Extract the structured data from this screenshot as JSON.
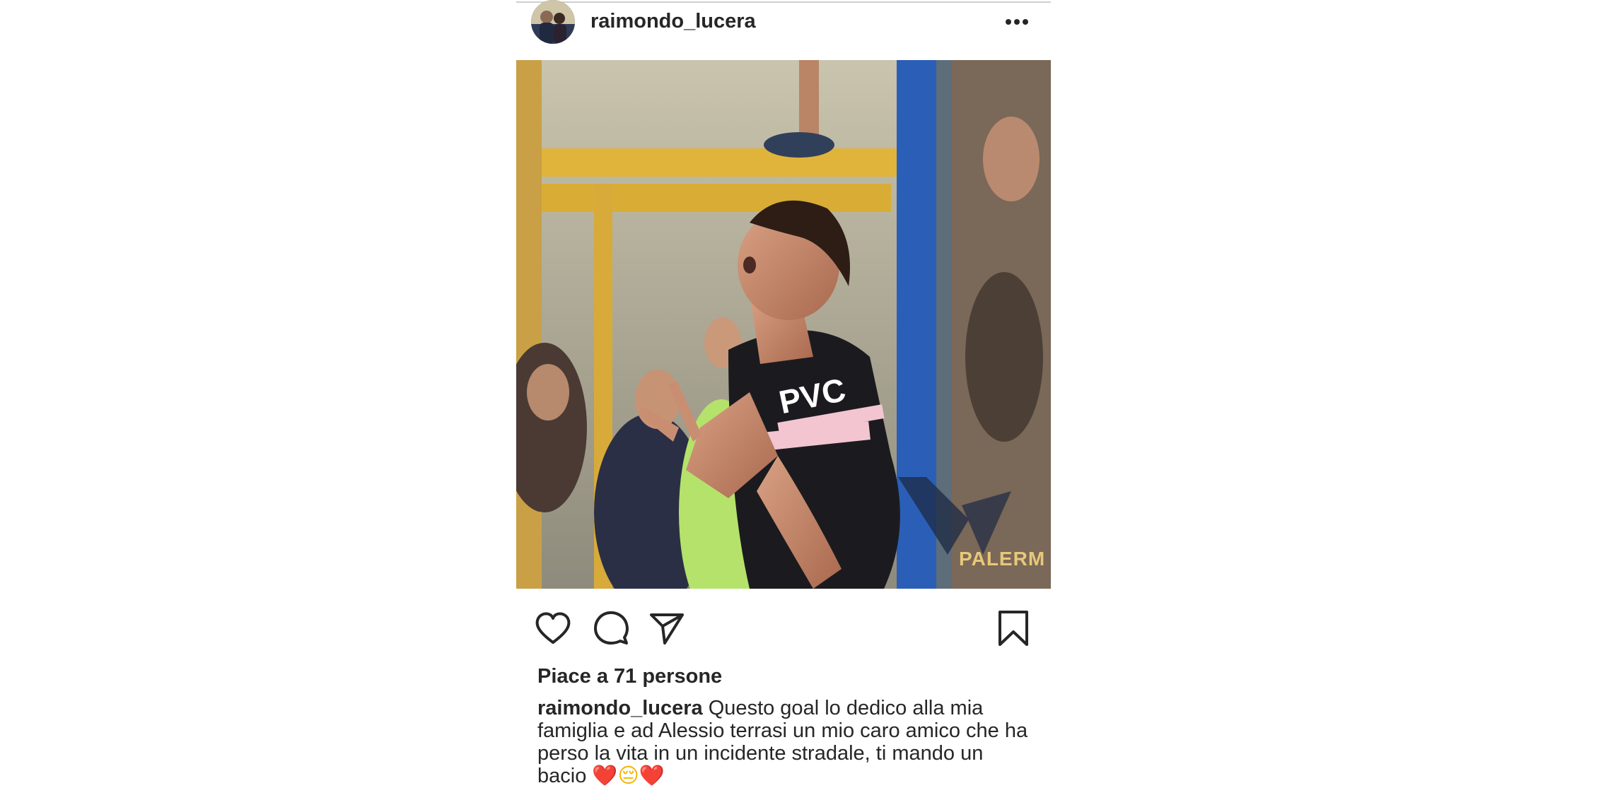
{
  "post": {
    "username": "raimondo_lucera",
    "more_label": "•••",
    "image": {
      "description_visible_text": "PALERM"
    },
    "actions": {
      "like_icon": "heart-outline-icon",
      "comment_icon": "comment-bubble-icon",
      "share_icon": "paper-plane-icon",
      "save_icon": "bookmark-icon"
    },
    "likes_text": "Piace a 71 persone",
    "caption": {
      "username": "raimondo_lucera",
      "text": "Questo goal lo dedico alla mia famiglia e ad Alessio terrasi un mio caro amico che ha perso la vita in un incidente stradale, ti mando un bacio",
      "emoji_1": "❤️",
      "emoji_2": "😔",
      "emoji_3": "❤️"
    }
  },
  "colors": {
    "text": "#262626",
    "background": "#ffffff",
    "heart_red": "#e0212e"
  }
}
